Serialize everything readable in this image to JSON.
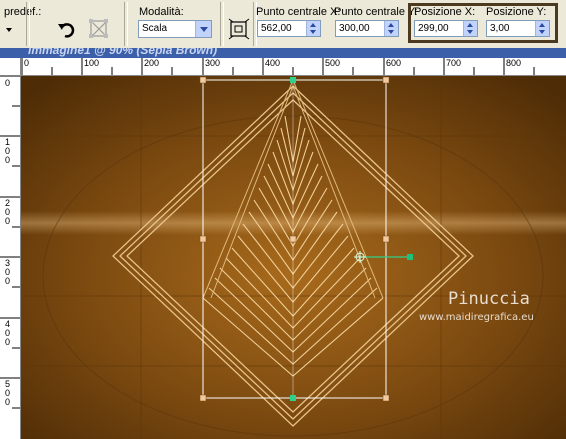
{
  "toolbar": {
    "preset_label": "predef.:",
    "mode_label": "Modalità:",
    "mode_value": "Scala",
    "center_x_label": "Punto centrale X:",
    "center_x_value": "562,00",
    "center_y_label": "Punto centrale Y:",
    "center_y_value": "300,00",
    "pos_x_label": "Posizione X:",
    "pos_x_value": "299,00",
    "pos_y_label": "Posizione Y:",
    "pos_y_value": "3,00"
  },
  "window": {
    "title": "Immagine1 @ 90% (Sepia Brown)"
  },
  "ruler": {
    "top_ticks": [
      "0",
      "100",
      "200",
      "300",
      "400",
      "500",
      "600",
      "700",
      "800"
    ],
    "left_ticks": [
      "0",
      "100",
      "200",
      "300",
      "400",
      "500"
    ]
  },
  "watermark": {
    "name": "Pinuccia",
    "url": "www.maidiregrafica.eu"
  },
  "colors": {
    "accent": "#3b5fa8",
    "canvas": "#7a4a10",
    "handle": "#1fc07a",
    "highlight_frame": "#4b3a20"
  }
}
